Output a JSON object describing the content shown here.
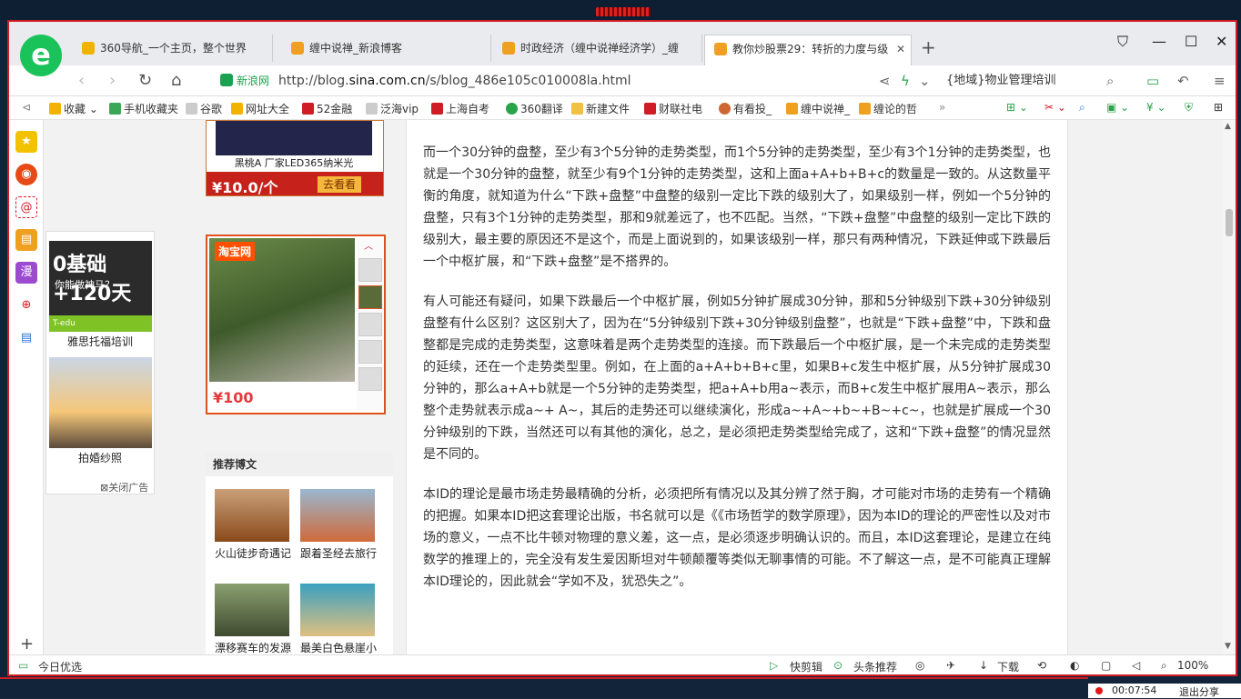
{
  "tabs": [
    {
      "label": "360导航_一个主页，整个世界",
      "color": "#f2b200"
    },
    {
      "label": "缠中说禅_新浪博客",
      "color": "#f0a020"
    },
    {
      "label": "时政经济（缠中说禅经济学）_缠",
      "color": "#f0a020"
    },
    {
      "label": "教你炒股票29：转折的力度与级",
      "color": "#f0a020",
      "active": true
    }
  ],
  "browser": {
    "logo": "e",
    "new_tab": "+",
    "url_site": "新浪网",
    "url_prefix": "http://blog.",
    "url_host": "sina.com.cn",
    "url_path": "/s/blog_486e105c010008la.html",
    "search_text": "{地域}物业管理培训"
  },
  "bookmarks": [
    {
      "label": "收藏",
      "color": "#f2b200"
    },
    {
      "label": "手机收藏夹",
      "color": "#3aa757"
    },
    {
      "label": "谷歌",
      "color": "#cccccc"
    },
    {
      "label": "网址大全",
      "color": "#f2b200"
    },
    {
      "label": "52金融",
      "color": "#d01c24"
    },
    {
      "label": "泛海vip",
      "color": "#cccccc"
    },
    {
      "label": "上海自考",
      "color": "#d01c24"
    },
    {
      "label": "360翻译",
      "color": "#2aa34a"
    },
    {
      "label": "新建文件",
      "color": "#f0c040"
    },
    {
      "label": "财联社电",
      "color": "#d01c24"
    },
    {
      "label": "有看投_",
      "color": "#cc6633"
    },
    {
      "label": "缠中说禅_",
      "color": "#f0a020"
    },
    {
      "label": "缠论的哲",
      "color": "#f0a020"
    }
  ],
  "ads": {
    "top_name": "黑桃A 厂家LED365纳米光",
    "top_price": "¥10.0/个",
    "top_button": "去看看",
    "taobao_logo": "淘宝网",
    "taobao_price": "¥100",
    "left_big": "0基础+120天",
    "left_q": "你能做神马？",
    "left_band": "T-edu",
    "left_caption1": "雅思托福培训",
    "left_caption2": "拍婚纱照",
    "close_label": "关闭广告"
  },
  "recommend": {
    "title": "推荐博文",
    "items": [
      {
        "label": "火山徒步奇遇记"
      },
      {
        "label": "跟着圣经去旅行"
      },
      {
        "label": "漂移赛车的发源"
      },
      {
        "label": "最美白色悬崖小"
      }
    ]
  },
  "article": {
    "paragraphs": [
      "而一个30分钟的盘整，至少有3个5分钟的走势类型，而1个5分钟的走势类型，至少有3个1分钟的走势类型，也就是一个30分钟的盘整，就至少有9个1分钟的走势类型，这和上面a+A+b+B+c的数量是一致的。从这数量平衡的角度，就知道为什么“下跌+盘整”中盘整的级别一定比下跌的级别大了，如果级别一样，例如一个5分钟的盘整，只有3个1分钟的走势类型，那和9就差远了，也不匹配。当然，“下跌+盘整”中盘整的级别一定比下跌的级别大，最主要的原因还不是这个，而是上面说到的，如果该级别一样，那只有两种情况，下跌延伸或下跌最后一个中枢扩展，和“下跌+盘整”是不搭界的。",
      "有人可能还有疑问，如果下跌最后一个中枢扩展，例如5分钟扩展成30分钟，那和5分钟级别下跌+30分钟级别盘整有什么区别？这区别大了，因为在“5分钟级别下跌+30分钟级别盘整”，也就是“下跌+盘整”中，下跌和盘整都是完成的走势类型，这意味着是两个走势类型的连接。而下跌最后一个中枢扩展，是一个未完成的走势类型的延续，还在一个走势类型里。例如，在上面的a+A+b+B+c里，如果B+c发生中枢扩展，从5分钟扩展成30分钟的，那么a+A+b就是一个5分钟的走势类型，把a+A+b用a~表示，而B+c发生中枢扩展用A~表示，那么整个走势就表示成a~+ A~，其后的走势还可以继续演化，形成a~+A~+b~+B~+c~，也就是扩展成一个30分钟级别的下跌，当然还可以有其他的演化，总之，是必须把走势类型给完成了，这和“下跌+盘整”的情况显然是不同的。",
      "本ID的理论是最市场走势最精确的分析，必须把所有情况以及其分辨了然于胸，才可能对市场的走势有一个精确的把握。如果本ID把这套理论出版，书名就可以是《《市场哲学的数学原理》，因为本ID的理论的严密性以及对市场的意义，一点不比牛顿对物理的意义差，这一点，是必须逐步明确认识的。而且，本ID这套理论，是建立在纯数学的推理上的，完全没有发生爱因斯坦对牛顿颠覆等类似无聊事情的可能。不了解这一点，是不可能真正理解本ID理论的，因此就会“学如不及，犹恐失之”。"
    ]
  },
  "status": {
    "left": "今日优选",
    "kuaijianji": "快剪辑",
    "toutiao": "头条推荐",
    "download": "下载",
    "zoom": "100%"
  },
  "recording": {
    "time": "00:07:54",
    "exit": "退出分享"
  }
}
